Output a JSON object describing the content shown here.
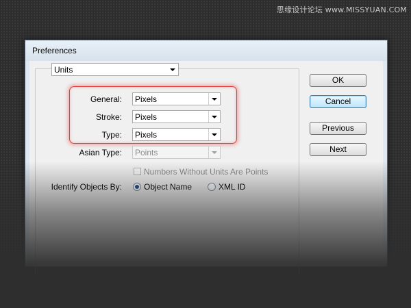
{
  "watermark": "思缘设计论坛 www.MISSYUAN.COM",
  "window": {
    "title": "Preferences"
  },
  "category": {
    "value": "Units"
  },
  "units": {
    "general": {
      "label": "General:",
      "value": "Pixels"
    },
    "stroke": {
      "label": "Stroke:",
      "value": "Pixels"
    },
    "type": {
      "label": "Type:",
      "value": "Pixels"
    },
    "asian_type": {
      "label": "Asian Type:",
      "value": "Points"
    }
  },
  "numbers_without_units": {
    "label": "Numbers Without Units Are Points",
    "checked": false
  },
  "identify_objects": {
    "label": "Identify Objects By:",
    "options": [
      {
        "label": "Object Name",
        "selected": true
      },
      {
        "label": "XML ID",
        "selected": false
      }
    ]
  },
  "buttons": {
    "ok": "OK",
    "cancel": "Cancel",
    "previous": "Previous",
    "next": "Next"
  },
  "colors": {
    "highlight": "#e23b3b",
    "default_button": "#bee6fd",
    "background": "#2e2e2e"
  }
}
